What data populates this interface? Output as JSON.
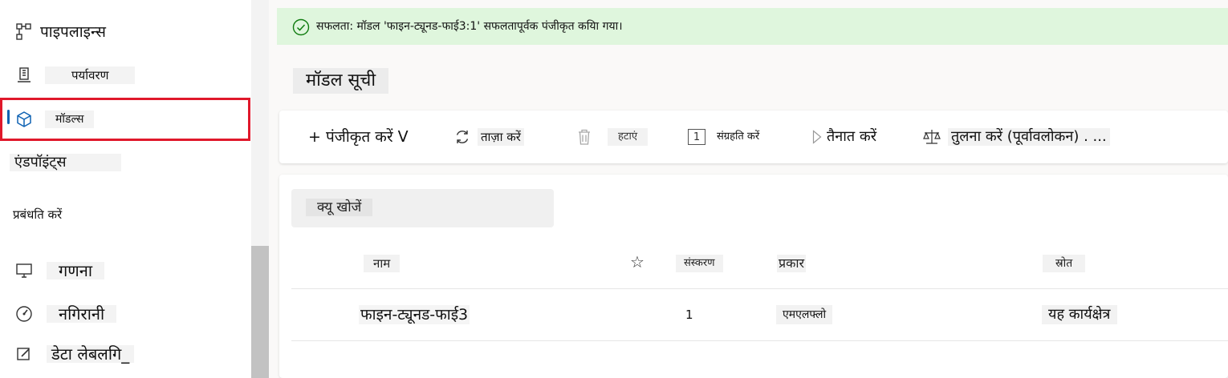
{
  "sidebar": {
    "items": [
      {
        "label": "पाइपलाइन्स",
        "icon": "pipeline-icon"
      },
      {
        "label": "पर्यावरण",
        "icon": "environment-icon"
      },
      {
        "label": "मॉडल्स",
        "icon": "cube-icon",
        "selected": true
      },
      {
        "label": "एंडपॉइंट्स",
        "icon": "endpoint-icon"
      },
      {
        "label": "गणना",
        "icon": "compute-icon"
      },
      {
        "label": "नगिरानी",
        "icon": "monitor-gauge-icon"
      },
      {
        "label": "डेटा लेबलगि_",
        "icon": "edit-label-icon"
      }
    ],
    "manage_heading": "प्रबंधति करें"
  },
  "banner": {
    "text": "सफलता: मॉडल 'फाइन-ट्यूनड-फाई3:1' सफलतापूर्वक पंजीकृत कयिा गया।",
    "icon": "success-check-icon",
    "color": "#dff6dd"
  },
  "page": {
    "title": "मॉडल सूची"
  },
  "toolbar": {
    "register_label": "+ पंजीकृत करें ᐯ",
    "refresh_label": "ताज़ा करें",
    "delete_label": "हटाएं",
    "archive_badge": "1",
    "archive_label": "संग्रहति करें",
    "deploy_label": "तैनात करें",
    "compare_label": "तुलना करें (पूर्वावलोकन) . ..."
  },
  "search": {
    "placeholder": "क्यू खोजें"
  },
  "table": {
    "columns": {
      "name": "नाम",
      "version": "संस्करण",
      "type": "प्रकार",
      "source": "स्रोत"
    },
    "rows": [
      {
        "name": "फाइन-ट्यूनड-फाई3",
        "version": "1",
        "type": "एमएलफ्लो",
        "source": "यह कार्यक्षेत्र"
      }
    ]
  },
  "colors": {
    "selection_outline": "#e0182b",
    "accent": "#0f62b3",
    "success_bg": "#dff6dd"
  }
}
